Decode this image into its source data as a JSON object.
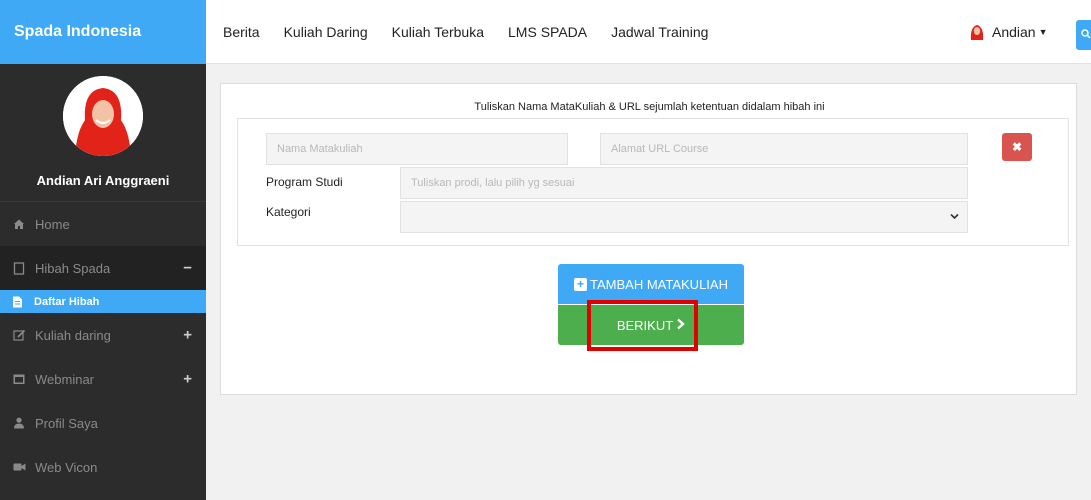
{
  "brand": "Spada Indonesia",
  "profile": {
    "name": "Andian Ari Anggraeni"
  },
  "sidebar": {
    "items": [
      {
        "label": "Home"
      },
      {
        "label": "Hibah Spada",
        "toggle": "−"
      },
      {
        "label": "Daftar Hibah"
      },
      {
        "label": "Kuliah daring",
        "toggle": "+"
      },
      {
        "label": "Webminar",
        "toggle": "+"
      },
      {
        "label": "Profil Saya"
      },
      {
        "label": "Web Vicon"
      }
    ]
  },
  "nav": {
    "links": [
      "Berita",
      "Kuliah Daring",
      "Kuliah Terbuka",
      "LMS SPADA",
      "Jadwal Training"
    ]
  },
  "user_menu": {
    "name": "Andian"
  },
  "form": {
    "title": "Tuliskan Nama MataKuliah & URL sejumlah ketentuan didalam hibah ini",
    "nama_placeholder": "Nama Matakuliah",
    "url_placeholder": "Alamat URL Course",
    "prodi_label": "Program Studi",
    "prodi_placeholder": "Tuliskan prodi, lalu pilih yg sesuai",
    "kategori_label": "Kategori",
    "kategori_value": ""
  },
  "buttons": {
    "add_label": "TAMBAH MATAKULIAH",
    "next_label": "BERIKUT"
  },
  "colors": {
    "brand": "#3fa9f5",
    "sidebar": "#2c2c2c",
    "danger": "#d9534f",
    "success": "#4cae4c",
    "highlight": "#e00000"
  }
}
